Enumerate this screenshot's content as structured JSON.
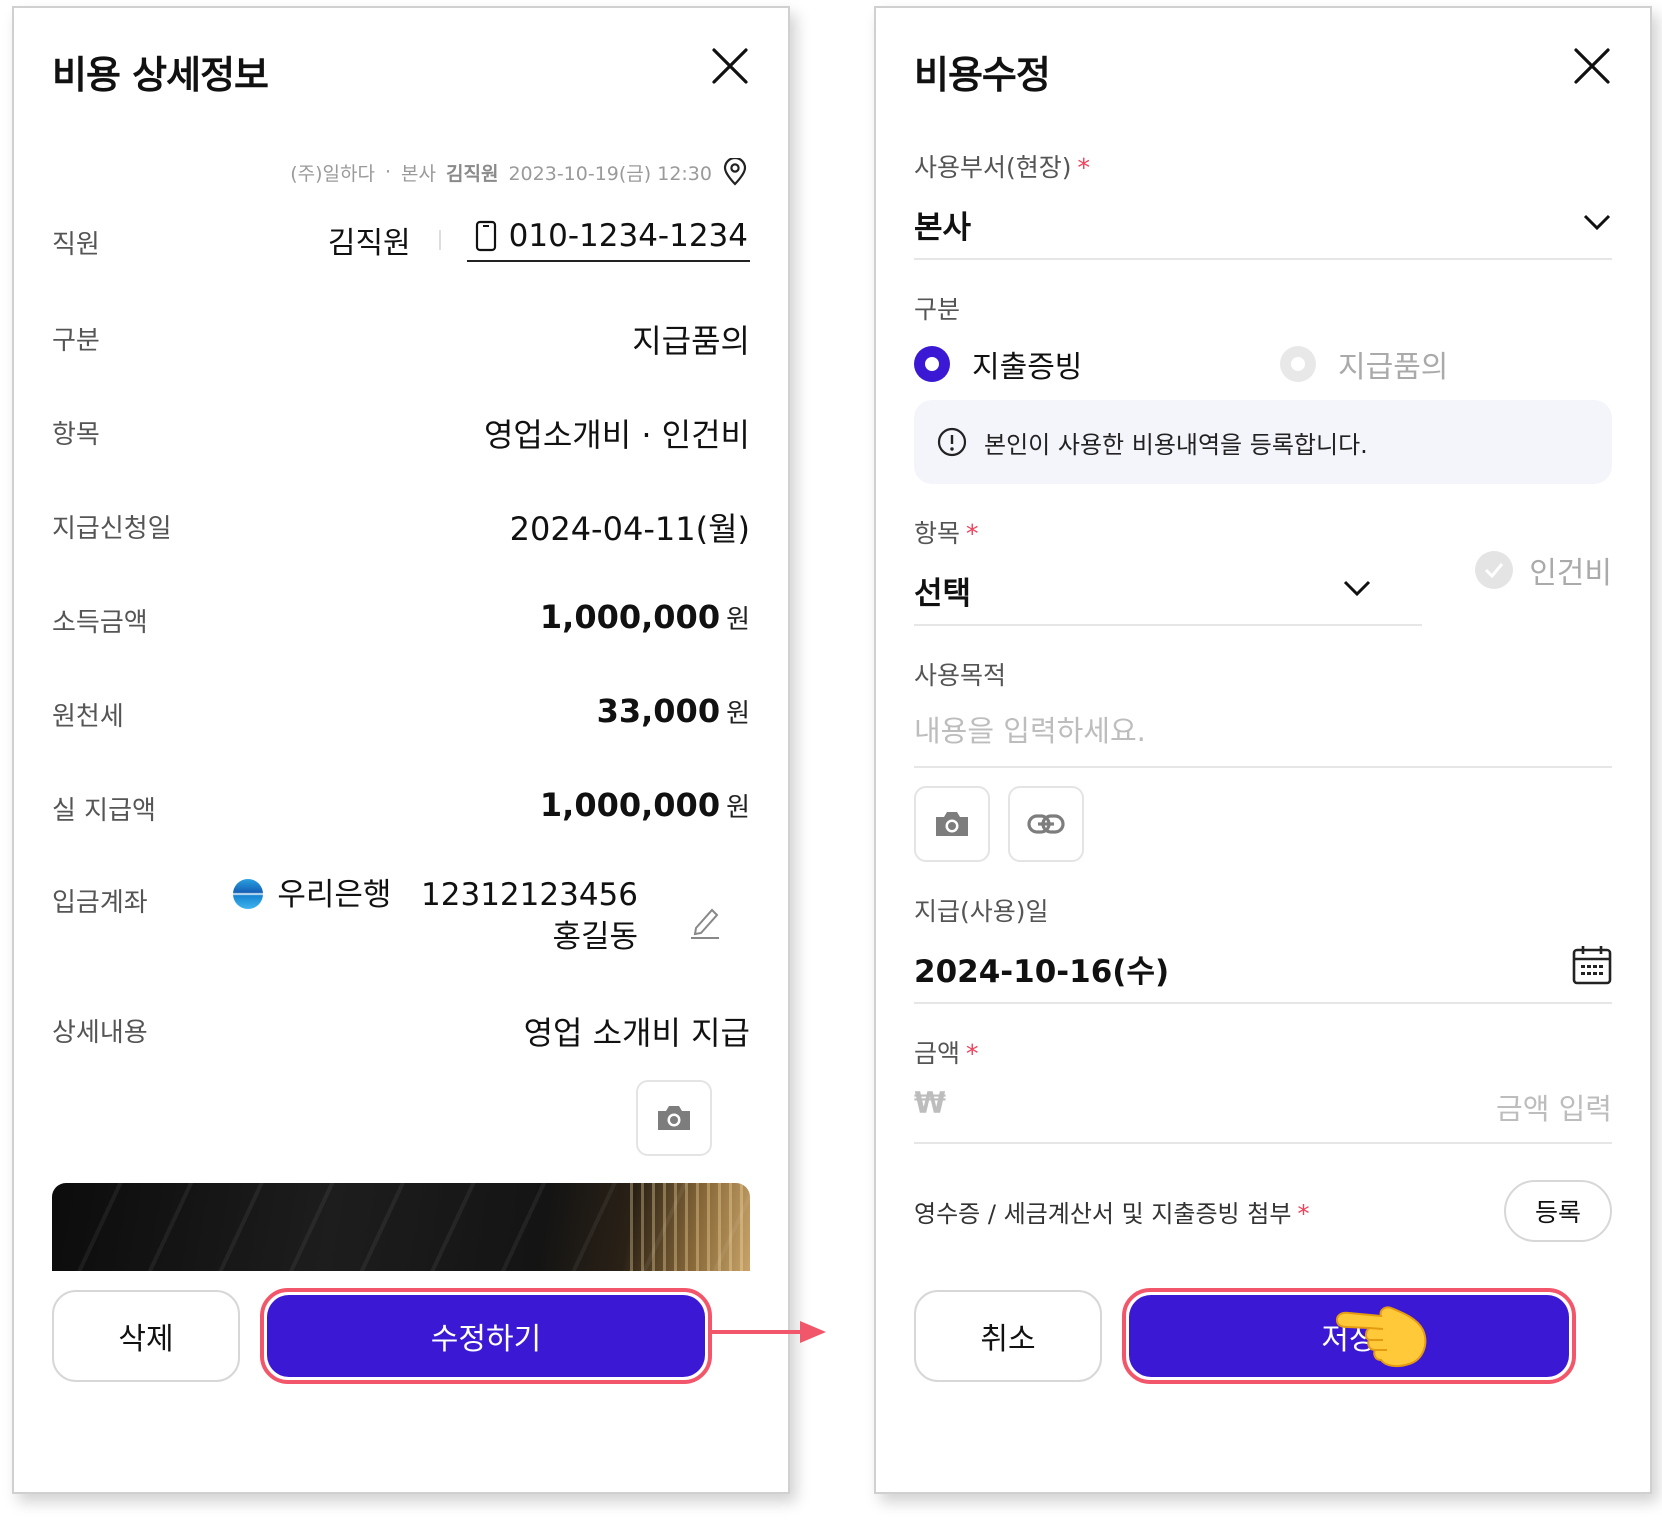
{
  "left": {
    "title": "비용 상세정보",
    "meta": {
      "company": "(주)일하다",
      "dept": "본사",
      "user": "김직원",
      "datetime": "2023-10-19(금) 12:30"
    },
    "rows": {
      "employee": {
        "label": "직원",
        "name": "김직원",
        "phone": "010-1234-1234"
      },
      "category": {
        "label": "구분",
        "value": "지급품의"
      },
      "item": {
        "label": "항목",
        "value": "영업소개비 · 인건비"
      },
      "request_date": {
        "label": "지급신청일",
        "value": "2024-04-11(월)"
      },
      "income": {
        "label": "소득금액",
        "value": "1,000,000",
        "unit": "원"
      },
      "tax": {
        "label": "원천세",
        "value": "33,000",
        "unit": "원"
      },
      "net": {
        "label": "실 지급액",
        "value": "1,000,000",
        "unit": "원"
      },
      "account": {
        "label": "입금계좌",
        "bank": "우리은행",
        "number": "12312123456",
        "holder": "홍길동"
      },
      "detail": {
        "label": "상세내용",
        "value": "영업 소개비 지급"
      }
    },
    "buttons": {
      "delete": "삭제",
      "edit": "수정하기"
    }
  },
  "right": {
    "title": "비용수정",
    "dept": {
      "label": "사용부서(현장)",
      "value": "본사"
    },
    "type": {
      "label": "구분",
      "options": [
        "지출증빙",
        "지급품의"
      ],
      "selected": "지출증빙"
    },
    "info": "본인이 사용한 비용내역을 등록합니다.",
    "item": {
      "label": "항목",
      "value": "선택",
      "checkbox": "인건비"
    },
    "purpose": {
      "label": "사용목적",
      "placeholder": "내용을 입력하세요."
    },
    "date": {
      "label": "지급(사용)일",
      "value": "2024-10-16(수)"
    },
    "amount": {
      "label": "금액",
      "currency": "₩",
      "placeholder": "금액 입력"
    },
    "attach": {
      "label": "영수증 / 세금계산서 및 지출증빙 첨부",
      "button": "등록"
    },
    "buttons": {
      "cancel": "취소",
      "save": "저장"
    }
  },
  "required_mark": "*",
  "colors": {
    "primary": "#3a18d4",
    "highlight": "#f2566a",
    "required": "#f0405a"
  }
}
